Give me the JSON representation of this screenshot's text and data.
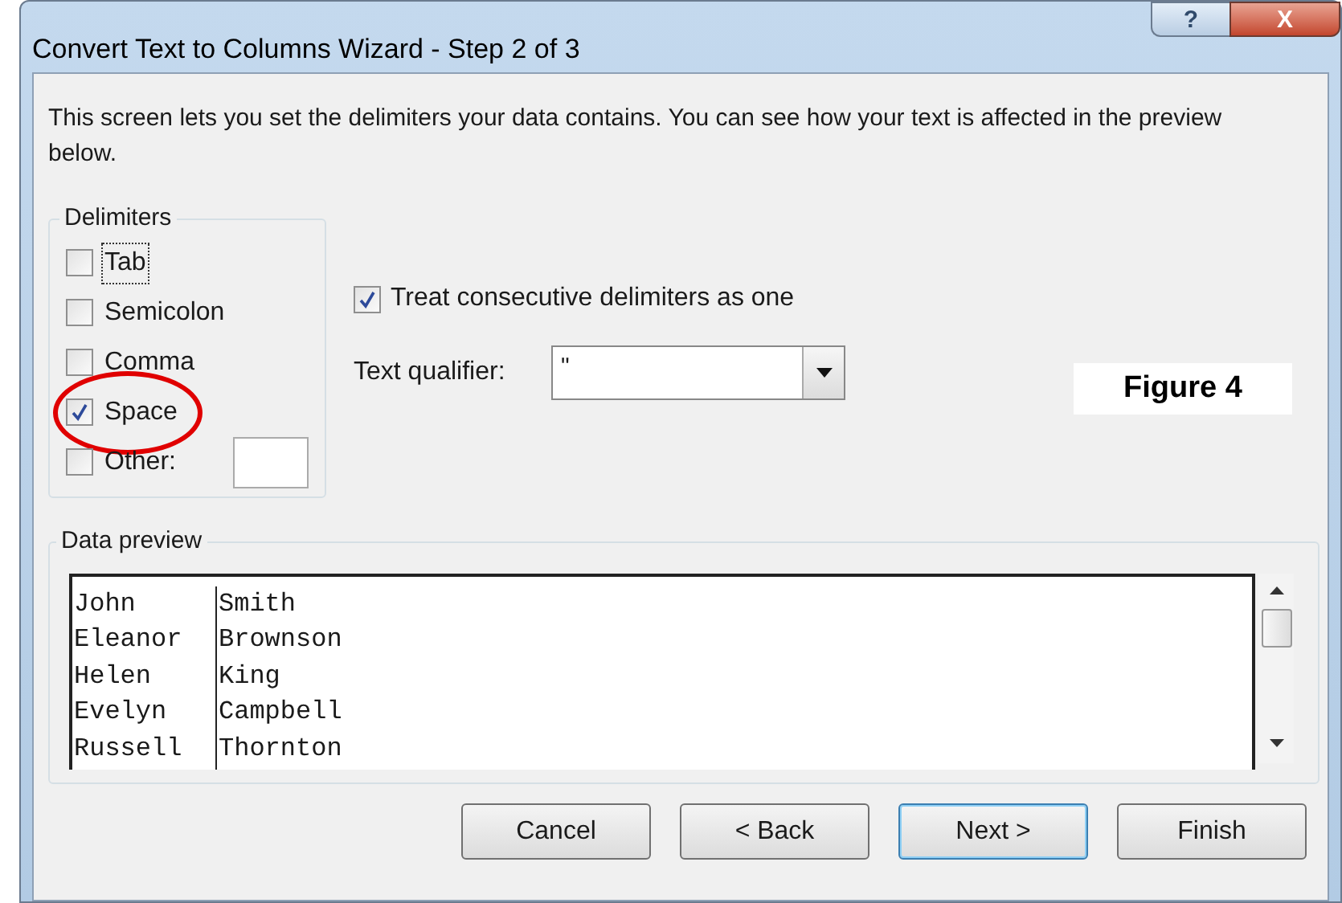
{
  "window": {
    "title": "Convert Text to Columns Wizard - Step 2 of 3",
    "title_buttons": [
      {
        "kind": "help",
        "label": "?"
      },
      {
        "kind": "close",
        "label": "X"
      }
    ]
  },
  "intro": "This screen lets you set the delimiters your data contains.  You can see how your text is affected in the preview below.",
  "delimiters": {
    "legend": "Delimiters",
    "items": [
      {
        "label": "Tab",
        "checked": false,
        "focused": true,
        "circled": false,
        "has_field": false
      },
      {
        "label": "Semicolon",
        "checked": false,
        "focused": false,
        "circled": false,
        "has_field": false
      },
      {
        "label": "Comma",
        "checked": false,
        "focused": false,
        "circled": false,
        "has_field": false
      },
      {
        "label": "Space",
        "checked": true,
        "focused": false,
        "circled": true,
        "has_field": false
      },
      {
        "label": "Other:",
        "checked": false,
        "focused": false,
        "circled": false,
        "has_field": true
      }
    ]
  },
  "treat_consecutive": {
    "label": "Treat consecutive delimiters as one",
    "checked": true
  },
  "text_qualifier": {
    "label": "Text qualifier:",
    "value": "\""
  },
  "caption": "Figure 4",
  "data_preview": {
    "legend": "Data preview",
    "rows": [
      [
        "John",
        "Smith"
      ],
      [
        "Eleanor",
        "Brownson"
      ],
      [
        "Helen",
        "King"
      ],
      [
        "Evelyn",
        "Campbell"
      ],
      [
        "Russell",
        "Thornton"
      ]
    ]
  },
  "buttons": [
    {
      "label": "Cancel",
      "default": false
    },
    {
      "label": "< Back",
      "default": false
    },
    {
      "label": "Next >",
      "default": true
    },
    {
      "label": "Finish",
      "default": false
    }
  ]
}
